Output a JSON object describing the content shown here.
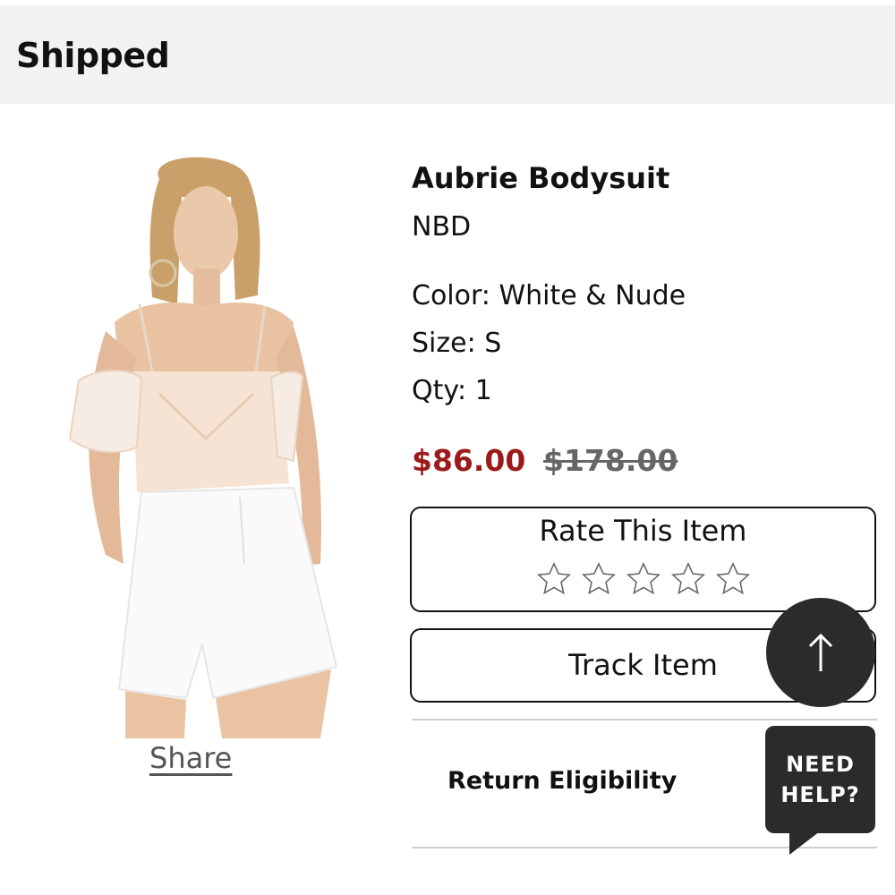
{
  "header": {
    "title": "Shipped"
  },
  "product": {
    "name": "Aubrie Bodysuit",
    "brand": "NBD",
    "color": "Color: White & Nude",
    "size": "Size: S",
    "qty": "Qty: 1",
    "sale_price": "$86.00",
    "original_price": "$178.00",
    "share_label": "Share"
  },
  "rating": {
    "label": "Rate This Item",
    "max_stars": 5,
    "current": 0
  },
  "actions": {
    "track_label": "Track Item",
    "return_label": "Return Eligibility"
  },
  "floating": {
    "help_label_line1": "NEED",
    "help_label_line2": "HELP?",
    "back_to_top_icon": "arrow-up-icon"
  },
  "colors": {
    "sale_price": "#9b1b1b",
    "header_bg": "#f2f2f2",
    "floating_bg": "#2b2b2b"
  }
}
